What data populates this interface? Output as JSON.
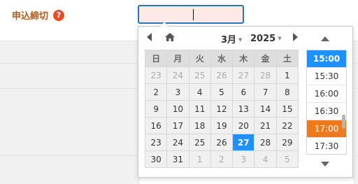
{
  "form": {
    "label": "申込締切",
    "help_icon": "?",
    "date_input_value": ""
  },
  "calendar": {
    "month_label": "3月",
    "year_label": "2025",
    "weekdays": [
      "日",
      "月",
      "火",
      "水",
      "木",
      "金",
      "土"
    ],
    "weeks": [
      [
        {
          "d": "23",
          "o": true
        },
        {
          "d": "24",
          "o": true
        },
        {
          "d": "25",
          "o": true
        },
        {
          "d": "26",
          "o": true
        },
        {
          "d": "27",
          "o": true
        },
        {
          "d": "28",
          "o": true
        },
        {
          "d": "1",
          "o": false
        }
      ],
      [
        {
          "d": "2",
          "o": false
        },
        {
          "d": "3",
          "o": false
        },
        {
          "d": "4",
          "o": false
        },
        {
          "d": "5",
          "o": false
        },
        {
          "d": "6",
          "o": false
        },
        {
          "d": "7",
          "o": false
        },
        {
          "d": "8",
          "o": false
        }
      ],
      [
        {
          "d": "9",
          "o": false
        },
        {
          "d": "10",
          "o": false
        },
        {
          "d": "11",
          "o": false
        },
        {
          "d": "12",
          "o": false
        },
        {
          "d": "13",
          "o": false
        },
        {
          "d": "14",
          "o": false
        },
        {
          "d": "15",
          "o": false
        }
      ],
      [
        {
          "d": "16",
          "o": false
        },
        {
          "d": "17",
          "o": false
        },
        {
          "d": "18",
          "o": false
        },
        {
          "d": "19",
          "o": false
        },
        {
          "d": "20",
          "o": false
        },
        {
          "d": "21",
          "o": false
        },
        {
          "d": "22",
          "o": false
        }
      ],
      [
        {
          "d": "23",
          "o": false
        },
        {
          "d": "24",
          "o": false
        },
        {
          "d": "25",
          "o": false
        },
        {
          "d": "26",
          "o": false
        },
        {
          "d": "27",
          "o": false,
          "sel": true
        },
        {
          "d": "28",
          "o": false
        },
        {
          "d": "29",
          "o": false
        }
      ],
      [
        {
          "d": "30",
          "o": false
        },
        {
          "d": "31",
          "o": false
        },
        {
          "d": "1",
          "o": true
        },
        {
          "d": "2",
          "o": true
        },
        {
          "d": "3",
          "o": true
        },
        {
          "d": "4",
          "o": true
        },
        {
          "d": "5",
          "o": true
        }
      ]
    ]
  },
  "times": [
    {
      "label": "15:00",
      "state": "selected"
    },
    {
      "label": "15:30",
      "state": ""
    },
    {
      "label": "16:00",
      "state": ""
    },
    {
      "label": "16:30",
      "state": ""
    },
    {
      "label": "17:00",
      "state": "current"
    },
    {
      "label": "17:30",
      "state": ""
    }
  ],
  "colors": {
    "accent": "#1e90ff",
    "current_time": "#ee7a1e",
    "label": "#b05a17",
    "help": "#e0502a",
    "input_border": "#2e72b8",
    "input_bg": "#fde9e7"
  }
}
